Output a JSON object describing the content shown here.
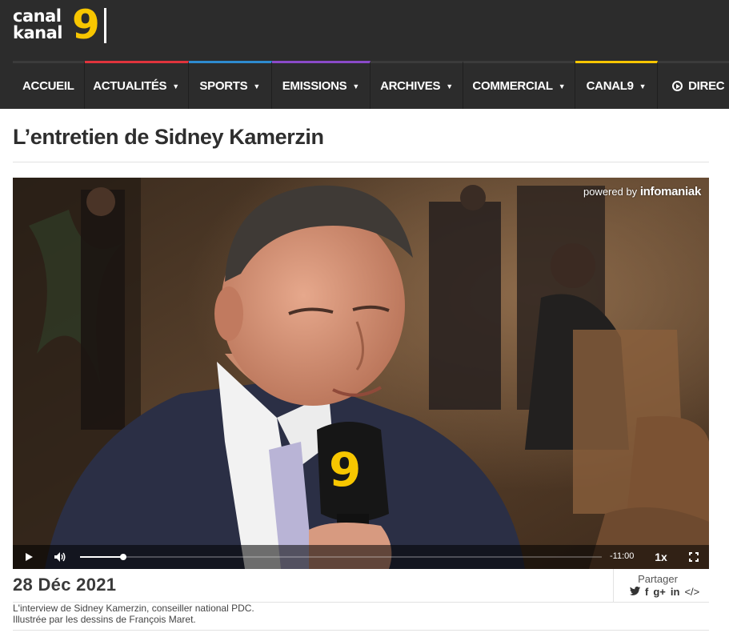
{
  "logo": {
    "line1": "canal",
    "line2": "kanal",
    "number": "9"
  },
  "nav": {
    "items": [
      {
        "label": "ACCUEIL",
        "accent": "#3b3b3b",
        "dropdown": false
      },
      {
        "label": "ACTUALITÉS",
        "accent": "#e0343c",
        "dropdown": true
      },
      {
        "label": "SPORTS",
        "accent": "#2e8bd0",
        "dropdown": true
      },
      {
        "label": "EMISSIONS",
        "accent": "#8a4ac9",
        "dropdown": true
      },
      {
        "label": "ARCHIVES",
        "accent": "#3b3b3b",
        "dropdown": true
      },
      {
        "label": "COMMERCIAL",
        "accent": "#3b3b3b",
        "dropdown": true
      },
      {
        "label": "CANAL9",
        "accent": "#f7c600",
        "dropdown": true
      },
      {
        "label": "DIREC",
        "accent": "#3b3b3b",
        "dropdown": false,
        "icon": "play-circle-icon"
      }
    ]
  },
  "page": {
    "title": "L’entretien de Sidney Kamerzin"
  },
  "player": {
    "powered_prefix": "powered by",
    "powered_brand": "infomaniak",
    "mic_logo": "9",
    "progress_fraction": 0.083,
    "time_remaining": "-11:00",
    "speed": "1x",
    "icons": {
      "play": "play-icon",
      "volume": "volume-icon",
      "fullscreen": "fullscreen-icon"
    }
  },
  "meta": {
    "date": "28 Déc 2021",
    "share_label": "Partager",
    "share_icons": [
      "twitter-icon",
      "facebook-icon",
      "google-plus-icon",
      "linkedin-icon",
      "embed-icon"
    ],
    "description_line1": "L'interview de Sidney Kamerzin, conseiller national PDC.",
    "description_line2": "Illustrée par les dessins de François Maret."
  },
  "colors": {
    "header_bg": "#2c2c2c",
    "brand_yellow": "#f7c600",
    "actualites_red": "#e0343c",
    "sports_blue": "#2e8bd0",
    "emissions_purple": "#8a4ac9"
  }
}
